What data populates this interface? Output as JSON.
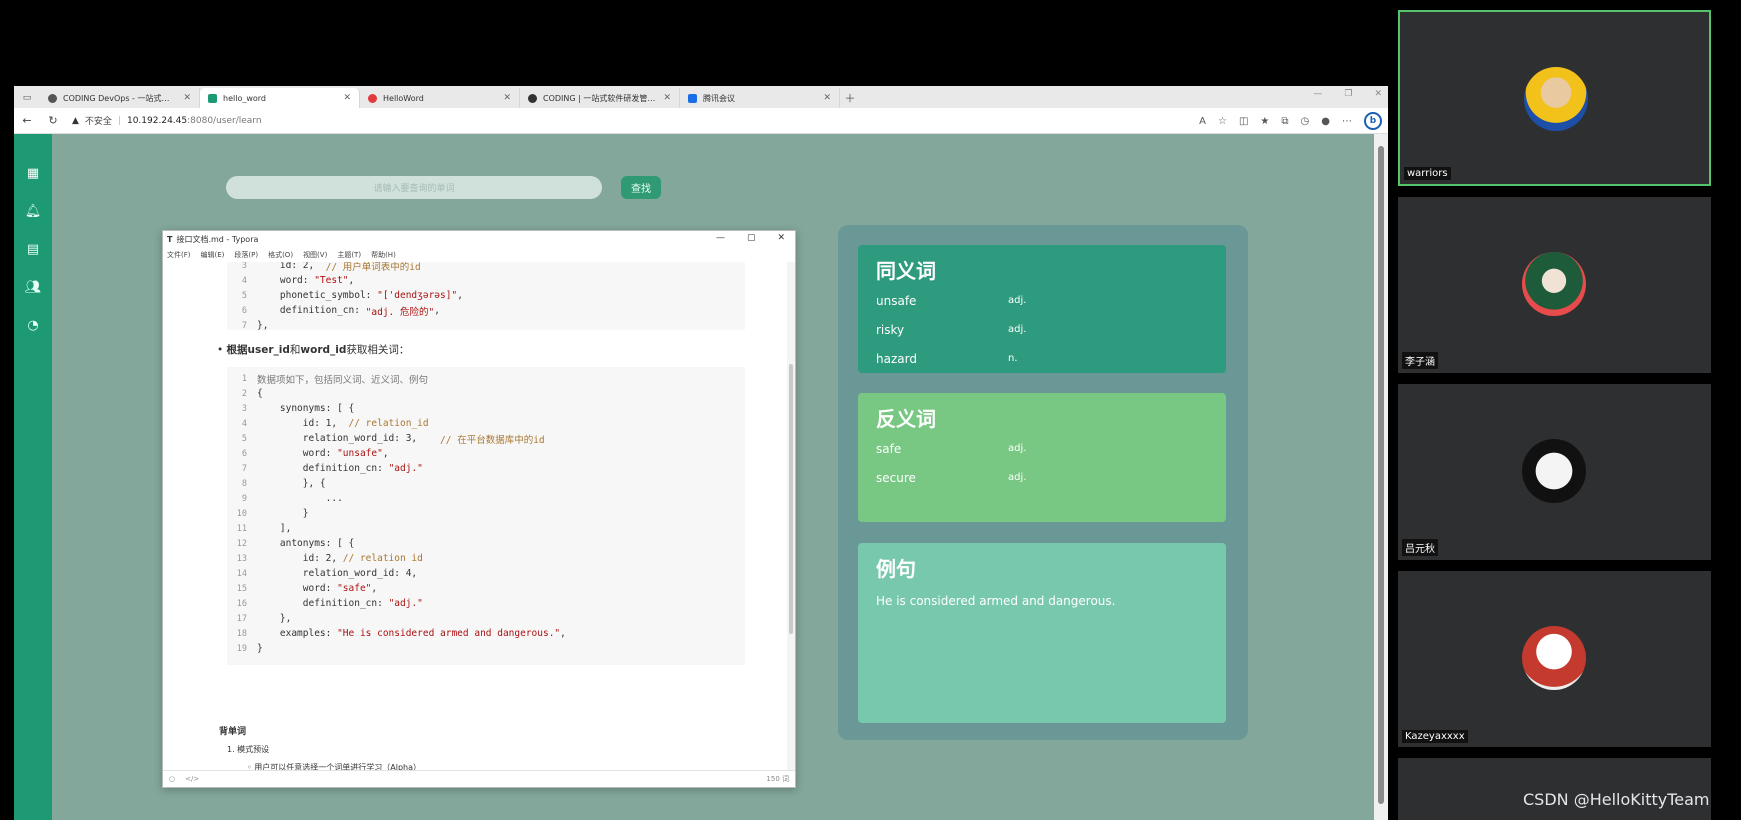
{
  "browser": {
    "tabs": [
      {
        "title": "CODING DevOps - 一站式软件研",
        "color": "#555"
      },
      {
        "title": "hello_word",
        "color": "#1d9a73"
      },
      {
        "title": "HelloWord",
        "color": "#e23b3b"
      },
      {
        "title": "CODING | 一站式软件研发管理平",
        "color": "#333"
      },
      {
        "title": "腾讯会议",
        "color": "#1a6fe6"
      }
    ],
    "url_warning": "不安全",
    "url_host": "10.192.24.45",
    "url_path": ":8080/user/learn"
  },
  "app": {
    "search_placeholder": "请输入要查询的单词",
    "search_button": "查找"
  },
  "cards": {
    "synonyms": {
      "title": "同义词",
      "items": [
        {
          "word": "unsafe",
          "pos": "adj."
        },
        {
          "word": "risky",
          "pos": "adj."
        },
        {
          "word": "hazard",
          "pos": "n."
        }
      ]
    },
    "antonyms": {
      "title": "反义词",
      "items": [
        {
          "word": "safe",
          "pos": "adj."
        },
        {
          "word": "secure",
          "pos": "adj."
        }
      ]
    },
    "examples": {
      "title": "例句",
      "sentence": "He is considered armed and dangerous."
    }
  },
  "typora": {
    "title": "接口文档.md - Typora",
    "menu": [
      "文件(F)",
      "编辑(E)",
      "段落(P)",
      "格式(O)",
      "视图(V)",
      "主题(T)",
      "帮助(H)"
    ],
    "bullet_bold1": "根据user_id",
    "bullet_mid": "和",
    "bullet_bold2": "word_id",
    "bullet_tail": "获取相关词：",
    "section_title": "背单词",
    "section_item": "1. 模式预设",
    "section_sub": "◦ 用户可以任意选择一个词单进行学习（Alpha）",
    "word_count": "150 词"
  },
  "participants": [
    {
      "name": "warriors"
    },
    {
      "name": "李子涵"
    },
    {
      "name": "吕元秋"
    },
    {
      "name": "Kazeyaxxxx"
    }
  ],
  "watermark": "CSDN @HelloKittyTeam"
}
